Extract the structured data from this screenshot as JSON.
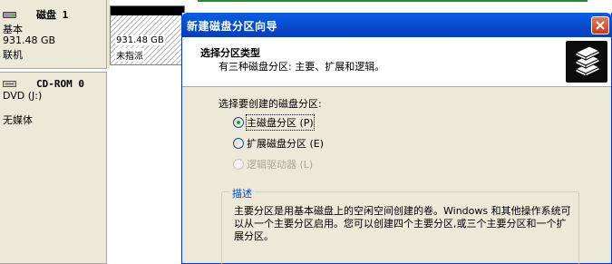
{
  "disk1": {
    "name": "磁盘 1",
    "type": "基本",
    "size": "931.48 GB",
    "status": "联机",
    "partition": {
      "size": "931.48 GB",
      "status": "未指派"
    }
  },
  "cdrom": {
    "name": "CD-ROM 0",
    "drive": "DVD (J:)",
    "media": "无媒体"
  },
  "wizard": {
    "title": "新建磁盘分区向导",
    "header_title": "选择分区类型",
    "header_subtitle": "有三种磁盘分区: 主要、扩展和逻辑。",
    "prompt": "选择要创建的磁盘分区:",
    "options": [
      {
        "label": "主磁盘分区 (P)",
        "checked": true,
        "enabled": true
      },
      {
        "label": "扩展磁盘分区 (E)",
        "checked": false,
        "enabled": true
      },
      {
        "label": "逻辑驱动器 (L)",
        "checked": false,
        "enabled": false
      }
    ],
    "desc_label": "描述",
    "desc_text": "主要分区是用基本磁盘上的空闲空间创建的卷。Windows 和其他操作系统可以从一个主要分区启用。您可以创建四个主要分区,或三个主要分区和一个扩展分区。"
  },
  "colors": {
    "titlebar": "#0651d6",
    "selected_radio": "#21a121",
    "group_label": "#0046d5",
    "partition_bar": "#000000"
  },
  "icons": [
    "hard-disk-icon",
    "cd-rom-icon",
    "close-icon",
    "wizard-disk-stack-icon"
  ]
}
